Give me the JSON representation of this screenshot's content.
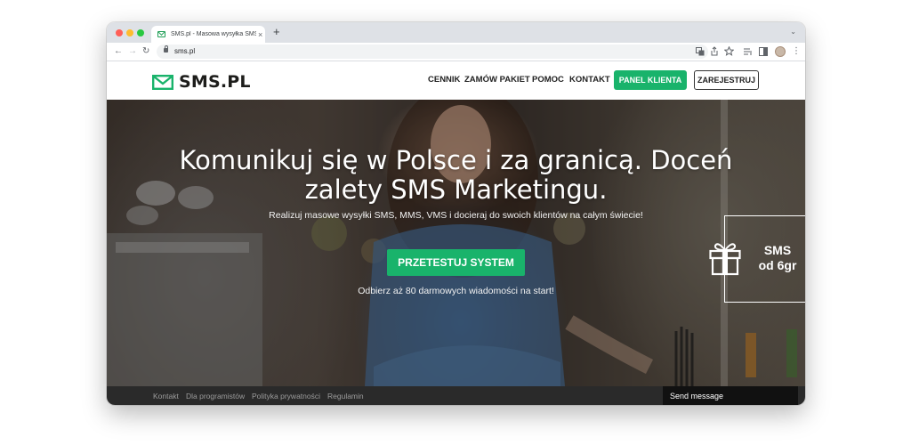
{
  "browser": {
    "tab_title": "SMS.pl - Masowa wysyłka SMS",
    "tab_close": "×",
    "new_tab": "+",
    "url": "sms.pl",
    "nav_back": "←",
    "nav_forward": "→",
    "nav_reload": "↻",
    "toolbar_icons": [
      "translate-icon",
      "share-icon",
      "star-icon",
      "reading-list-icon",
      "sidebar-icon",
      "profile-avatar",
      "menu-icon"
    ],
    "menu_glyph": "⋮",
    "tabs_dropdown": "⌄"
  },
  "site": {
    "logo_text": "SMS.PL",
    "nav": {
      "cennik": "CENNIK",
      "zamow": "ZAMÓW PAKIET",
      "pomoc": "POMOC",
      "kontakt": "KONTAKT"
    },
    "panel_button": "PANEL KLIENTA",
    "register_button": "ZAREJESTRUJ",
    "accent_color": "#19b36b"
  },
  "hero": {
    "title": "Komunikuj się w Polsce i za granicą. Doceń zalety SMS Marketingu.",
    "subtitle": "Realizuj masowe wysyłki SMS, MMS, VMS i docieraj do swoich klientów na całym świecie!",
    "cta": "PRZETESTUJ SYSTEM",
    "note": "Odbierz aż 80 darmowych wiadomości na start!",
    "promo_line1": "SMS",
    "promo_line2": "od 6gr"
  },
  "footer": {
    "links": [
      "Kontakt",
      "Dla programistów",
      "Polityka prywatności",
      "Regulamin"
    ],
    "send_message": "Send message"
  }
}
